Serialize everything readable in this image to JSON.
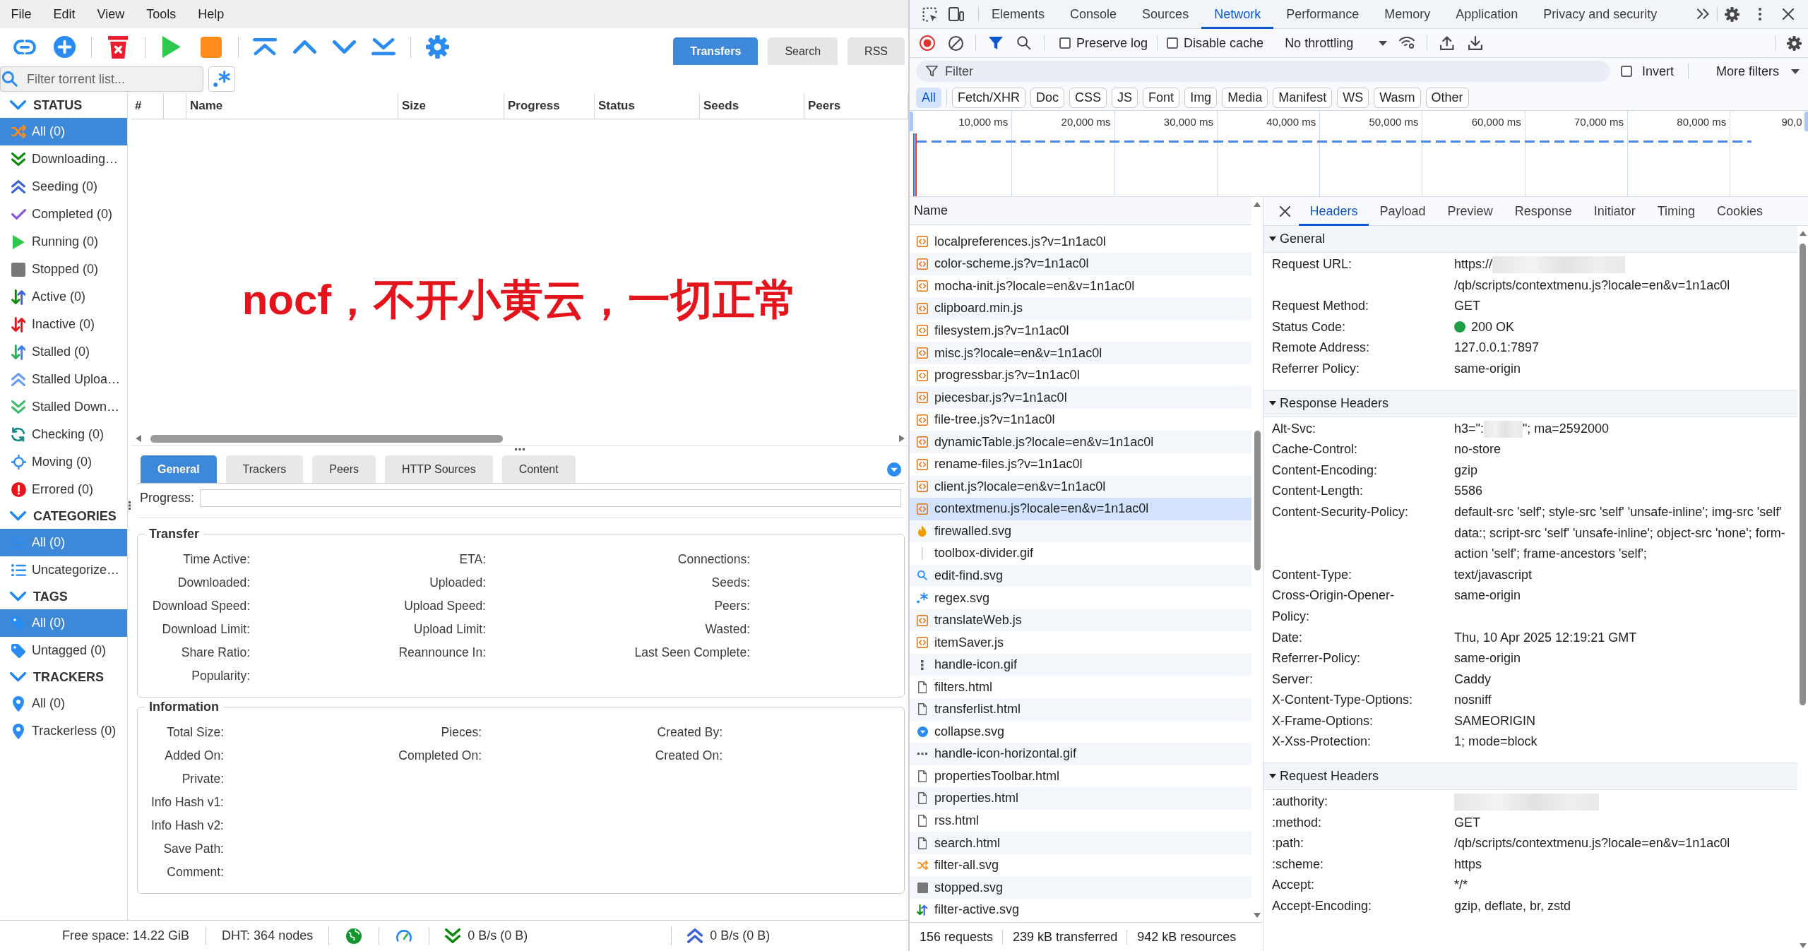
{
  "qbittorrent": {
    "menu": [
      "File",
      "Edit",
      "View",
      "Tools",
      "Help"
    ],
    "view_tabs": [
      {
        "label": "Transfers",
        "selected": true
      },
      {
        "label": "Search",
        "selected": false
      },
      {
        "label": "RSS",
        "selected": false
      }
    ],
    "filter": {
      "placeholder": "Filter torrent list..."
    },
    "sidebar": [
      {
        "title": "STATUS",
        "expanded": true,
        "items": [
          {
            "label": "All (0)",
            "selected": true
          },
          {
            "label": "Downloading…",
            "selected": false
          },
          {
            "label": "Seeding (0)",
            "selected": false
          },
          {
            "label": "Completed (0)",
            "selected": false
          },
          {
            "label": "Running (0)",
            "selected": false
          },
          {
            "label": "Stopped (0)",
            "selected": false
          },
          {
            "label": "Active (0)",
            "selected": false
          },
          {
            "label": "Inactive (0)",
            "selected": false
          },
          {
            "label": "Stalled (0)",
            "selected": false
          },
          {
            "label": "Stalled Uploa…",
            "selected": false
          },
          {
            "label": "Stalled Down…",
            "selected": false
          },
          {
            "label": "Checking (0)",
            "selected": false
          },
          {
            "label": "Moving (0)",
            "selected": false
          },
          {
            "label": "Errored (0)",
            "selected": false
          }
        ]
      },
      {
        "title": "CATEGORIES",
        "expanded": true,
        "items": [
          {
            "label": "All (0)",
            "selected": true
          },
          {
            "label": "Uncategorize…",
            "selected": false
          }
        ]
      },
      {
        "title": "TAGS",
        "expanded": true,
        "items": [
          {
            "label": "All (0)",
            "selected": true
          },
          {
            "label": "Untagged (0)",
            "selected": false
          }
        ]
      },
      {
        "title": "TRACKERS",
        "expanded": true,
        "items": [
          {
            "label": "All (0)",
            "selected": false
          },
          {
            "label": "Trackerless (0)",
            "selected": false
          }
        ]
      }
    ],
    "table": {
      "columns": [
        "#",
        "Name",
        "Size",
        "Progress",
        "Status",
        "Seeds",
        "Peers"
      ]
    },
    "annotation": "nocf，不开小黄云，一切正常",
    "detail_tabs": [
      {
        "label": "General",
        "selected": true
      },
      {
        "label": "Trackers",
        "selected": false
      },
      {
        "label": "Peers",
        "selected": false
      },
      {
        "label": "HTTP Sources",
        "selected": false
      },
      {
        "label": "Content",
        "selected": false
      }
    ],
    "progress": {
      "label": "Progress:"
    },
    "transfer": {
      "title": "Transfer",
      "rows": [
        [
          "Time Active:",
          "ETA:",
          "Connections:"
        ],
        [
          "Downloaded:",
          "Uploaded:",
          "Seeds:"
        ],
        [
          "Download Speed:",
          "Upload Speed:",
          "Peers:"
        ],
        [
          "Download Limit:",
          "Upload Limit:",
          "Wasted:"
        ],
        [
          "Share Ratio:",
          "Reannounce In:",
          "Last Seen Complete:"
        ],
        [
          "Popularity:"
        ]
      ]
    },
    "information": {
      "title": "Information",
      "rows": [
        [
          "Total Size:",
          "Pieces:",
          "Created By:"
        ],
        [
          "Added On:",
          "Completed On:",
          "Created On:"
        ],
        [
          "Private:"
        ],
        [
          "Info Hash v1:"
        ],
        [
          "Info Hash v2:"
        ],
        [
          "Save Path:"
        ],
        [
          "Comment:"
        ]
      ]
    },
    "status_bar": {
      "free_space": "Free space: 14.22 GiB",
      "dht": "DHT: 364 nodes",
      "download": "0 B/s (0 B)",
      "upload": "0 B/s (0 B)"
    }
  },
  "devtools": {
    "tabs": [
      {
        "label": "Elements",
        "selected": false
      },
      {
        "label": "Console",
        "selected": false
      },
      {
        "label": "Sources",
        "selected": false
      },
      {
        "label": "Network",
        "selected": true
      },
      {
        "label": "Performance",
        "selected": false
      },
      {
        "label": "Memory",
        "selected": false
      },
      {
        "label": "Application",
        "selected": false
      },
      {
        "label": "Privacy and security",
        "selected": false
      }
    ],
    "options": [
      {
        "label": "Preserve log",
        "checked": false
      },
      {
        "label": "Disable cache",
        "checked": false
      }
    ],
    "throttling": "No throttling",
    "filter": {
      "placeholder": "Filter"
    },
    "invert": {
      "label": "Invert",
      "checked": false
    },
    "more_filters": "More filters",
    "type_filters": [
      {
        "label": "All",
        "selected": true
      },
      {
        "label": "Fetch/XHR",
        "selected": false
      },
      {
        "label": "Doc",
        "selected": false
      },
      {
        "label": "CSS",
        "selected": false
      },
      {
        "label": "JS",
        "selected": false
      },
      {
        "label": "Font",
        "selected": false
      },
      {
        "label": "Img",
        "selected": false
      },
      {
        "label": "Media",
        "selected": false
      },
      {
        "label": "Manifest",
        "selected": false
      },
      {
        "label": "WS",
        "selected": false
      },
      {
        "label": "Wasm",
        "selected": false
      },
      {
        "label": "Other",
        "selected": false
      }
    ],
    "timeline_ticks": [
      "10,000 ms",
      "20,000 ms",
      "30,000 ms",
      "40,000 ms",
      "50,000 ms",
      "60,000 ms",
      "70,000 ms",
      "80,000 ms",
      "90,0"
    ],
    "requests": {
      "column": "Name",
      "rows": [
        {
          "name": "localpreferences.js?v=1n1ac0l",
          "kind": "script",
          "selected": false
        },
        {
          "name": "color-scheme.js?v=1n1ac0l",
          "kind": "script",
          "selected": false
        },
        {
          "name": "mocha-init.js?locale=en&v=1n1ac0l",
          "kind": "script",
          "selected": false
        },
        {
          "name": "clipboard.min.js",
          "kind": "script",
          "selected": false
        },
        {
          "name": "filesystem.js?v=1n1ac0l",
          "kind": "script",
          "selected": false
        },
        {
          "name": "misc.js?locale=en&v=1n1ac0l",
          "kind": "script",
          "selected": false
        },
        {
          "name": "progressbar.js?v=1n1ac0l",
          "kind": "script",
          "selected": false
        },
        {
          "name": "piecesbar.js?v=1n1ac0l",
          "kind": "script",
          "selected": false
        },
        {
          "name": "file-tree.js?v=1n1ac0l",
          "kind": "script",
          "selected": false
        },
        {
          "name": "dynamicTable.js?locale=en&v=1n1ac0l",
          "kind": "script",
          "selected": false
        },
        {
          "name": "rename-files.js?v=1n1ac0l",
          "kind": "script",
          "selected": false
        },
        {
          "name": "client.js?locale=en&v=1n1ac0l",
          "kind": "script",
          "selected": false
        },
        {
          "name": "contextmenu.js?locale=en&v=1n1ac0l",
          "kind": "script",
          "selected": true
        },
        {
          "name": "firewalled.svg",
          "kind": "image",
          "selected": false
        },
        {
          "name": "toolbox-divider.gif",
          "kind": "image",
          "selected": false
        },
        {
          "name": "edit-find.svg",
          "kind": "image",
          "selected": false
        },
        {
          "name": "regex.svg",
          "kind": "image",
          "selected": false
        },
        {
          "name": "translateWeb.js",
          "kind": "script",
          "selected": false
        },
        {
          "name": "itemSaver.js",
          "kind": "script",
          "selected": false
        },
        {
          "name": "handle-icon.gif",
          "kind": "image",
          "selected": false
        },
        {
          "name": "filters.html",
          "kind": "document",
          "selected": false
        },
        {
          "name": "transferlist.html",
          "kind": "document",
          "selected": false
        },
        {
          "name": "collapse.svg",
          "kind": "image",
          "selected": false
        },
        {
          "name": "handle-icon-horizontal.gif",
          "kind": "image",
          "selected": false
        },
        {
          "name": "propertiesToolbar.html",
          "kind": "document",
          "selected": false
        },
        {
          "name": "properties.html",
          "kind": "document",
          "selected": false
        },
        {
          "name": "rss.html",
          "kind": "document",
          "selected": false
        },
        {
          "name": "search.html",
          "kind": "document",
          "selected": false
        },
        {
          "name": "filter-all.svg",
          "kind": "image",
          "selected": false
        },
        {
          "name": "stopped.svg",
          "kind": "image",
          "selected": false
        },
        {
          "name": "filter-active.svg",
          "kind": "image",
          "selected": false
        }
      ]
    },
    "summary": [
      "156 requests",
      "239 kB transferred",
      "942 kB resources"
    ],
    "detail_tabs": [
      {
        "label": "Headers",
        "selected": true
      },
      {
        "label": "Payload",
        "selected": false
      },
      {
        "label": "Preview",
        "selected": false
      },
      {
        "label": "Response",
        "selected": false
      },
      {
        "label": "Initiator",
        "selected": false
      },
      {
        "label": "Timing",
        "selected": false
      },
      {
        "label": "Cookies",
        "selected": false
      }
    ],
    "sections": [
      {
        "title": "General",
        "expanded": true,
        "rows": [
          {
            "name": "Request URL:",
            "kind": "text",
            "value": "https://",
            "redacted": true,
            "value_after": "/qb/scripts/contextmenu.js?locale=en&v=1n1ac0l"
          },
          {
            "name": "Request Method:",
            "kind": "text",
            "value": "GET"
          },
          {
            "name": "Status Code:",
            "kind": "status",
            "value": "200 OK"
          },
          {
            "name": "Remote Address:",
            "kind": "text",
            "value": "127.0.0.1:7897"
          },
          {
            "name": "Referrer Policy:",
            "kind": "text",
            "value": "same-origin"
          }
        ]
      },
      {
        "title": "Response Headers",
        "expanded": true,
        "rows": [
          {
            "name": "Alt-Svc:",
            "kind": "text",
            "value": "h3=\":",
            "redacted": true,
            "value_after": "\"; ma=2592000"
          },
          {
            "name": "Cache-Control:",
            "kind": "text",
            "value": "no-store"
          },
          {
            "name": "Content-Encoding:",
            "kind": "text",
            "value": "gzip"
          },
          {
            "name": "Content-Length:",
            "kind": "text",
            "value": "5586"
          },
          {
            "name": "Content-Security-Policy:",
            "kind": "text",
            "value": "default-src 'self'; style-src 'self' 'unsafe-inline'; img-src 'self' data:; script-src 'self' 'unsafe-inline'; object-src 'none'; form-action 'self'; frame-ancestors 'self';"
          },
          {
            "name": "Content-Type:",
            "kind": "text",
            "value": "text/javascript"
          },
          {
            "name": "Cross-Origin-Opener-Policy:",
            "kind": "text",
            "value": "same-origin"
          },
          {
            "name": "Date:",
            "kind": "text",
            "value": "Thu, 10 Apr 2025 12:19:21 GMT"
          },
          {
            "name": "Referrer-Policy:",
            "kind": "text",
            "value": "same-origin"
          },
          {
            "name": "Server:",
            "kind": "text",
            "value": "Caddy"
          },
          {
            "name": "X-Content-Type-Options:",
            "kind": "text",
            "value": "nosniff"
          },
          {
            "name": "X-Frame-Options:",
            "kind": "text",
            "value": "SAMEORIGIN"
          },
          {
            "name": "X-Xss-Protection:",
            "kind": "text",
            "value": "1; mode=block"
          }
        ]
      },
      {
        "title": "Request Headers",
        "expanded": true,
        "rows": [
          {
            "name": ":authority:",
            "kind": "text",
            "redacted": true
          },
          {
            "name": ":method:",
            "kind": "text",
            "value": "GET"
          },
          {
            "name": ":path:",
            "kind": "text",
            "value": "/qb/scripts/contextmenu.js?locale=en&v=1n1ac0l"
          },
          {
            "name": ":scheme:",
            "kind": "text",
            "value": "https"
          },
          {
            "name": "Accept:",
            "kind": "text",
            "value": "*/*"
          },
          {
            "name": "Accept-Encoding:",
            "kind": "text",
            "value": "gzip, deflate, br, zstd"
          }
        ]
      }
    ]
  }
}
